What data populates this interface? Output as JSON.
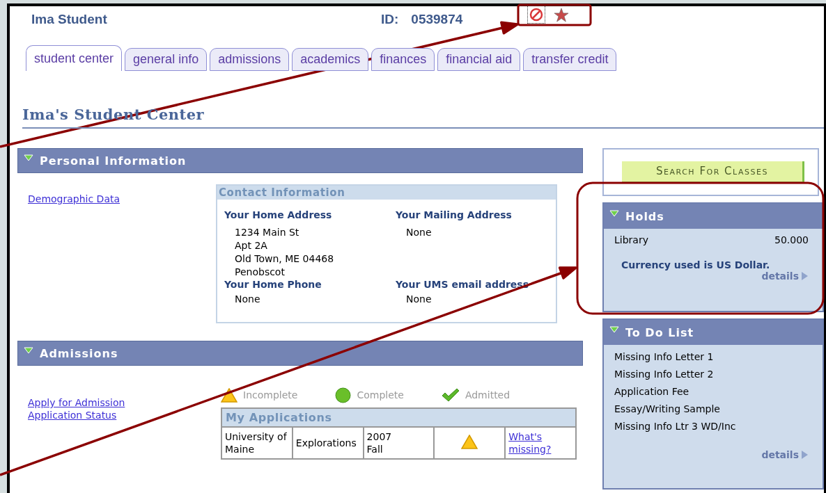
{
  "student": {
    "name": "Ima Student",
    "id_label": "ID:",
    "id": "0539874"
  },
  "tabs": [
    {
      "label": "student center",
      "selected": true
    },
    {
      "label": "general info",
      "selected": false
    },
    {
      "label": "admissions",
      "selected": false
    },
    {
      "label": "academics",
      "selected": false
    },
    {
      "label": "finances",
      "selected": false
    },
    {
      "label": "financial aid",
      "selected": false
    },
    {
      "label": "transfer credit",
      "selected": false
    }
  ],
  "page_title": "Ima's Student Center",
  "personal_information": {
    "title": "Personal Information",
    "expanded": true,
    "links": [
      "Demographic Data"
    ],
    "contact": {
      "title": "Contact Information",
      "fields": [
        {
          "label": "Your Home Address",
          "lines": [
            "1234 Main St",
            "Apt 2A",
            "Old Town, ME 04468",
            "Penobscot"
          ]
        },
        {
          "label": "Your Mailing Address",
          "lines": [
            "None"
          ]
        },
        {
          "label": "Your Home Phone",
          "lines": [
            "None"
          ]
        },
        {
          "label": "Your UMS email address",
          "lines": [
            "None"
          ]
        }
      ]
    }
  },
  "admissions": {
    "title": "Admissions",
    "expanded": true,
    "links": [
      "Apply for Admission",
      "Application Status"
    ],
    "legend": [
      {
        "kind": "incomplete",
        "label": "Incomplete"
      },
      {
        "kind": "complete",
        "label": "Complete"
      },
      {
        "kind": "admitted",
        "label": "Admitted"
      }
    ],
    "applications": {
      "title": "My Applications",
      "rows": [
        {
          "institution": "University of Maine",
          "program": "Explorations",
          "term": "2007 Fall",
          "kind": "incomplete",
          "action": "What's missing?"
        }
      ]
    }
  },
  "search_button": "Search For Classes",
  "holds": {
    "title": "Holds",
    "expanded": true,
    "items": [
      {
        "name": "Library",
        "amount": "50.000"
      }
    ],
    "note": "Currency used is US Dollar.",
    "details": "details"
  },
  "todo": {
    "title": "To Do List",
    "expanded": true,
    "items": [
      "Missing Info Letter 1",
      "Missing Info Letter 2",
      "Application Fee",
      "Essay/Writing Sample",
      "Missing Info Ltr 3 WD/Inc"
    ],
    "details": "details"
  }
}
